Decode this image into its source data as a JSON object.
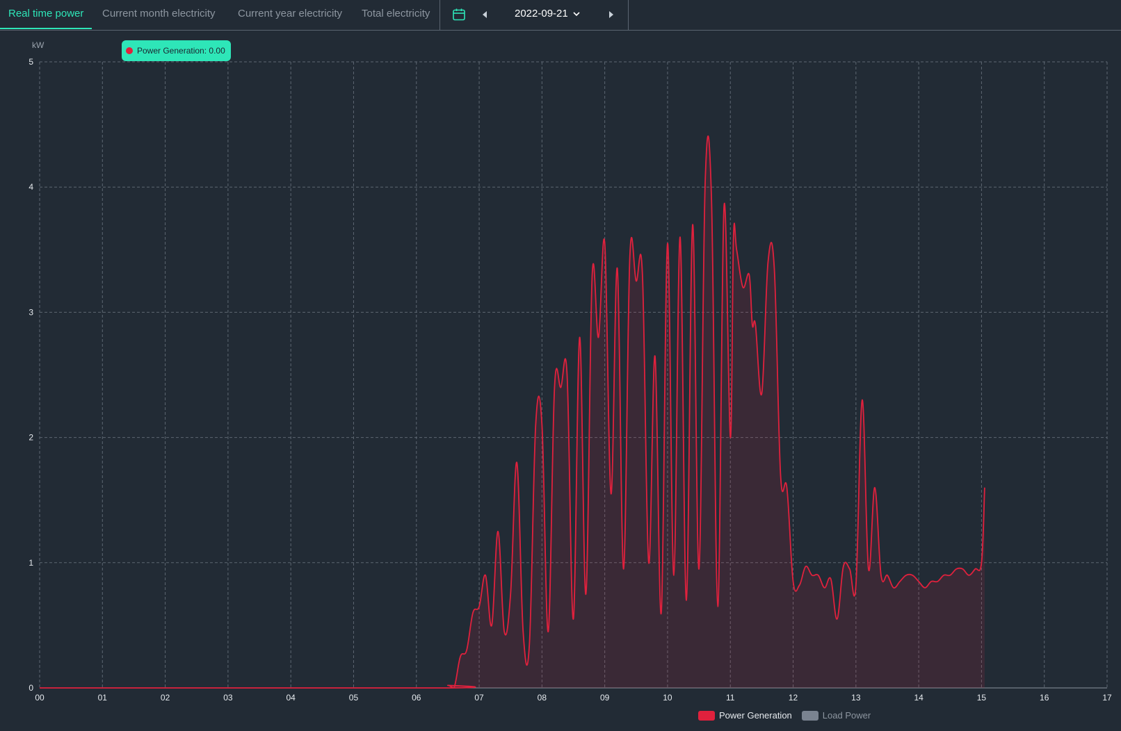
{
  "tabs": [
    {
      "label": "Real time power",
      "active": true
    },
    {
      "label": "Current month electricity",
      "active": false
    },
    {
      "label": "Current year electricity",
      "active": false
    },
    {
      "label": "Total electricity",
      "active": false
    }
  ],
  "date": "2022-09-21",
  "tooltip": {
    "text": "Power Generation: 0.00"
  },
  "colors": {
    "accent": "#2ee6b8",
    "series_power": "#e0213d",
    "series_load": "#7a8390",
    "background": "#222b35"
  },
  "chart_data": {
    "type": "area",
    "ylabel": "kW",
    "ylim": [
      0,
      5
    ],
    "y_ticks": [
      "0",
      "1",
      "2",
      "3",
      "4",
      "5"
    ],
    "xlim": [
      0,
      17
    ],
    "x_ticks": [
      "00",
      "01",
      "02",
      "03",
      "04",
      "05",
      "06",
      "07",
      "08",
      "09",
      "10",
      "11",
      "12",
      "13",
      "14",
      "15",
      "16",
      "17"
    ],
    "grid": true,
    "legend_position": "bottom",
    "series": [
      {
        "name": "Power Generation",
        "color": "#e0213d",
        "x": [
          0,
          6.4,
          6.5,
          6.6,
          6.7,
          6.8,
          6.9,
          7.0,
          7.1,
          7.2,
          7.3,
          7.4,
          7.5,
          7.6,
          7.7,
          7.8,
          7.9,
          8.0,
          8.1,
          8.2,
          8.3,
          8.4,
          8.5,
          8.6,
          8.7,
          8.8,
          8.9,
          9.0,
          9.1,
          9.2,
          9.3,
          9.4,
          9.5,
          9.6,
          9.7,
          9.8,
          9.9,
          10.0,
          10.1,
          10.2,
          10.3,
          10.4,
          10.5,
          10.6,
          10.7,
          10.8,
          10.9,
          11.0,
          11.05,
          11.1,
          11.2,
          11.3,
          11.35,
          11.4,
          11.5,
          11.6,
          11.7,
          11.8,
          11.9,
          12.0,
          12.1,
          12.2,
          12.3,
          12.4,
          12.5,
          12.6,
          12.7,
          12.8,
          12.9,
          13.0,
          13.1,
          13.2,
          13.3,
          13.4,
          13.5,
          13.6,
          13.7,
          13.8,
          13.9,
          14.0,
          14.1,
          14.2,
          14.3,
          14.4,
          14.5,
          14.6,
          14.7,
          14.8,
          14.9,
          15.0,
          15.05
        ],
        "values": [
          0,
          0,
          0.02,
          0,
          0.25,
          0.3,
          0.6,
          0.65,
          0.9,
          0.5,
          1.25,
          0.45,
          0.75,
          1.8,
          0.45,
          0.35,
          2.1,
          2.1,
          0.45,
          2.4,
          2.4,
          2.5,
          0.55,
          2.8,
          0.75,
          3.3,
          2.8,
          3.55,
          1.55,
          3.35,
          0.95,
          3.45,
          3.25,
          3.3,
          1.0,
          2.65,
          0.6,
          3.55,
          0.9,
          3.6,
          0.7,
          3.7,
          0.95,
          4.05,
          3.9,
          0.65,
          3.85,
          2.0,
          3.6,
          3.5,
          3.2,
          3.3,
          2.9,
          2.9,
          2.35,
          3.4,
          3.35,
          1.7,
          1.6,
          0.85,
          0.82,
          0.97,
          0.9,
          0.9,
          0.8,
          0.87,
          0.55,
          0.97,
          0.95,
          0.82,
          2.3,
          0.95,
          1.6,
          0.9,
          0.9,
          0.8,
          0.85,
          0.9,
          0.9,
          0.85,
          0.8,
          0.85,
          0.85,
          0.9,
          0.9,
          0.95,
          0.95,
          0.9,
          0.95,
          1.0,
          1.6
        ]
      },
      {
        "name": "Load Power",
        "color": "#7a8390",
        "x": [],
        "values": []
      }
    ]
  }
}
